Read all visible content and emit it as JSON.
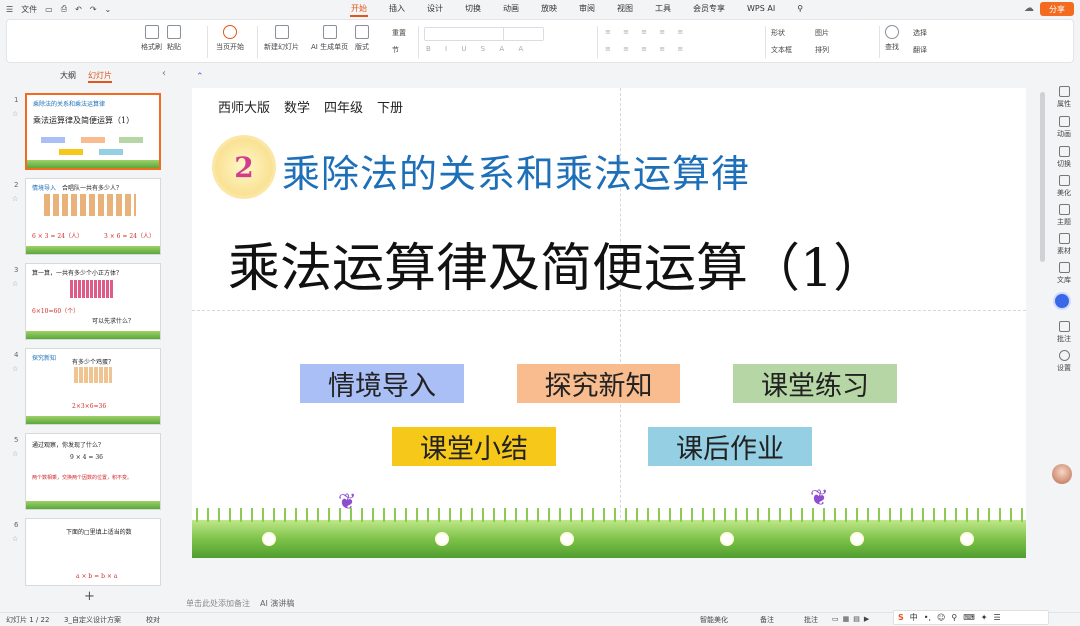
{
  "menubar": {
    "file": "文件",
    "tabs": [
      "开始",
      "插入",
      "设计",
      "切换",
      "动画",
      "放映",
      "审阅",
      "视图",
      "工具",
      "会员专享"
    ],
    "wps_ai": "WPS AI",
    "share": "分享"
  },
  "ribbon": {
    "format_painter": "格式刷",
    "paste": "粘贴",
    "play_from_current": "当页开始",
    "new_slide": "新建幻灯片",
    "ai_generate": "AI 生成单页",
    "layout": "版式",
    "section": "节",
    "reset": "重置",
    "shape": "形状",
    "picture": "图片",
    "textbox": "文本框",
    "arrange": "排列",
    "find": "查找",
    "select": "选择",
    "translate": "翻译"
  },
  "left_panel": {
    "tab_outline": "大纲",
    "tab_slides": "幻灯片",
    "slides": [
      {
        "num": "1",
        "line1": "乘除法的关系和乘法运算律",
        "line2": "乘法运算律及简便运算（1）"
      },
      {
        "num": "2",
        "line1": "情境导入",
        "line2": "合唱队一共有多少人？",
        "line3": "6 × 3 = 24（人）",
        "line4": "3 × 6 = 24（人）"
      },
      {
        "num": "3",
        "line1": "算一算，一共有多少个小正方体？",
        "line2": "6×10=60（个）",
        "line3": "可以先求什么？"
      },
      {
        "num": "4",
        "line1": "探究新知",
        "line2": "有多少个鸡蛋？",
        "line3": "2×3×6=36"
      },
      {
        "num": "5",
        "line1": "通过观察，你发现了什么？",
        "line2": "9 × 4 = 36",
        "line3": "两个数相乘，交换两个因数的位置，积不变。"
      },
      {
        "num": "6",
        "line1": "下面的□里填上适当的数",
        "line2": "a × b = b × a"
      }
    ]
  },
  "slide": {
    "publisher": "西师大版",
    "subject": "数学",
    "grade": "四年级",
    "term": "下册",
    "unit_number": "2",
    "chapter": "乘除法的关系和乘法运算律",
    "title": "乘法运算律及简便运算（1）",
    "buttons": [
      "情境导入",
      "探究新知",
      "课堂练习",
      "课堂小结",
      "课后作业"
    ]
  },
  "notes": {
    "placeholder": "单击此处添加备注",
    "ai_speech": "AI 演讲稿"
  },
  "right_bar": [
    "属性",
    "动画",
    "切换",
    "美化",
    "主题",
    "素材",
    "文库",
    "批注",
    "设置"
  ],
  "status": {
    "slide_counter": "幻灯片 1 / 22",
    "theme": "3_自定义设计方案",
    "proofread": "校对",
    "smart_beautify": "智能美化",
    "notes_btn": "备注",
    "comments_btn": "批注",
    "ime_lang": "中"
  },
  "colors": {
    "accent": "#e0561d",
    "chip_intro": "#aabff5",
    "chip_explore": "#f8bc8e",
    "chip_practice": "#b6d7a5",
    "chip_summary": "#f6c81a",
    "chip_homework": "#94cfe3",
    "chapter_blue": "#1d6fb8"
  }
}
